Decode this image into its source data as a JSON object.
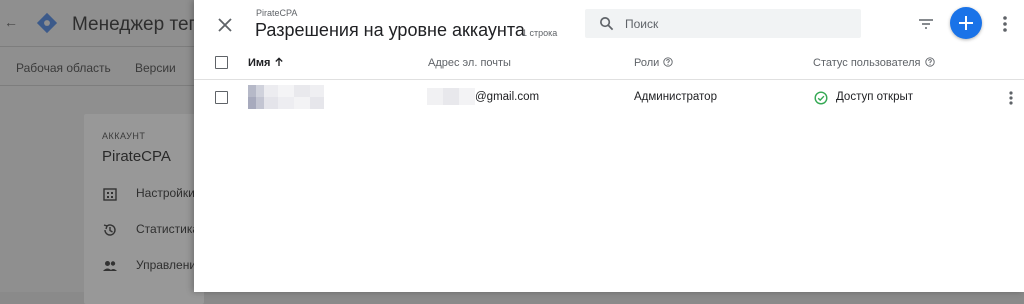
{
  "background": {
    "back_glyph": "←",
    "app_title": "Менеджер тегов",
    "nav_tabs": [
      "Рабочая область",
      "Версии"
    ],
    "card_eyebrow": "АККАУНТ",
    "card_title": "PirateCPA",
    "menu_items": [
      {
        "label": "Настройки аккаунта",
        "icon": "building-icon"
      },
      {
        "label": "Статистика",
        "icon": "history-icon"
      },
      {
        "label": "Управление пользователями",
        "icon": "people-icon"
      }
    ]
  },
  "dialog": {
    "breadcrumb": "PirateCPA",
    "title": "Разрешения на уровне аккаунта",
    "count": "1 строка",
    "search_placeholder": "Поиск",
    "accent_color": "#1a73e8"
  },
  "table": {
    "columns": [
      {
        "label": "Имя",
        "sorted": "ascending"
      },
      {
        "label": "Адрес эл. почты"
      },
      {
        "label": "Роли",
        "help": true
      },
      {
        "label": "Статус пользователя",
        "help": true
      }
    ],
    "rows": [
      {
        "name": "",
        "email": "@gmail.com",
        "role": "Администратор",
        "status": "Доступ открыт",
        "status_color": "#34a853"
      }
    ]
  }
}
